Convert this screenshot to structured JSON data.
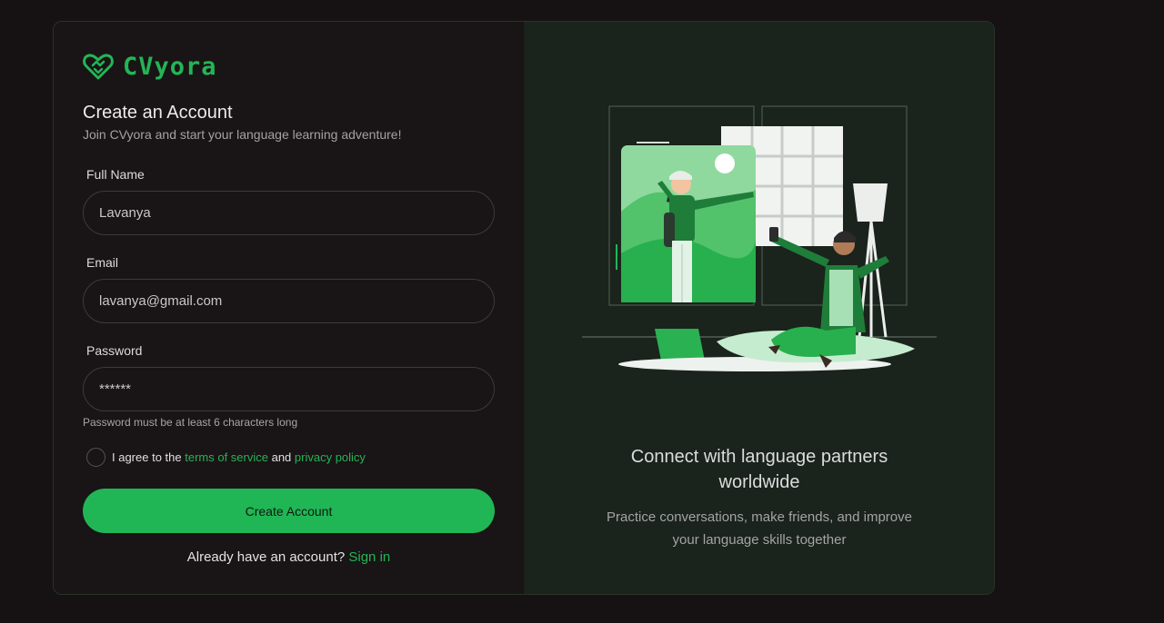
{
  "brand": {
    "name": "CVyora",
    "icon": "heart-handshake-icon"
  },
  "form": {
    "title": "Create an Account",
    "subtitle": "Join CVyora and start your language learning adventure!",
    "full_name": {
      "label": "Full Name",
      "value": "Lavanya"
    },
    "email": {
      "label": "Email",
      "value": "lavanya@gmail.com"
    },
    "password": {
      "label": "Password",
      "value": "******",
      "hint": "Password must be at least 6 characters long"
    },
    "agree": {
      "checked": false,
      "prefix": "I agree to the ",
      "terms_link": "terms of service",
      "middle": " and ",
      "privacy_link": "privacy policy"
    },
    "submit_label": "Create Account",
    "signin_prompt": "Already have an account? ",
    "signin_link": "Sign in"
  },
  "promo": {
    "title_line1": "Connect with language partners",
    "title_line2": "worldwide",
    "text_line1": "Practice conversations, make friends, and improve",
    "text_line2": "your language skills together"
  },
  "colors": {
    "accent": "#20b655",
    "left_panel": "#191415",
    "right_panel": "#1a231c",
    "page_background": "#161213"
  }
}
